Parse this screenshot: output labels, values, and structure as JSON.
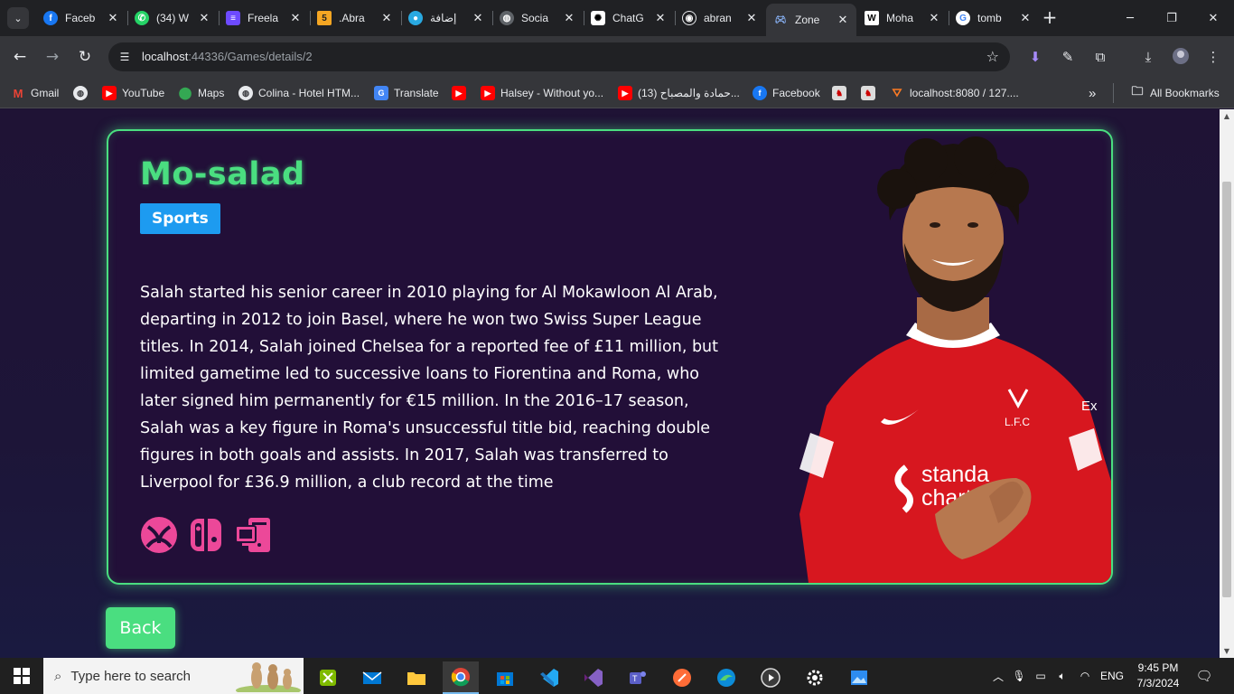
{
  "browser": {
    "tabs": [
      {
        "label": "Faceb",
        "icon": "facebook-icon",
        "color": "#1877f2"
      },
      {
        "label": "(34) W",
        "icon": "whatsapp-icon",
        "color": "#25d366"
      },
      {
        "label": "Freela",
        "icon": "freelancer-icon",
        "color": "#6d4aff"
      },
      {
        "label": ".Abra",
        "icon": "five-icon",
        "color": "#f5a623"
      },
      {
        "label": "إضافة",
        "icon": "circle-icon",
        "color": "#29a9e1"
      },
      {
        "label": "Socia",
        "icon": "globe-icon",
        "color": "#9aa0a6"
      },
      {
        "label": "ChatG",
        "icon": "chatgpt-icon",
        "color": "#ffffff"
      },
      {
        "label": "abran",
        "icon": "github-icon",
        "color": "#ffffff"
      },
      {
        "label": "Zone",
        "icon": "gamepad-icon",
        "color": "#8ab4f8",
        "active": true
      },
      {
        "label": "Moha",
        "icon": "wikipedia-icon",
        "color": "#ffffff"
      },
      {
        "label": "tomb",
        "icon": "google-icon",
        "color": "#ffffff"
      }
    ],
    "url_host": "localhost",
    "url_path": ":44336/Games/details/2",
    "bookmarks": [
      {
        "label": "Gmail",
        "icon": "gmail-icon"
      },
      {
        "label": "",
        "icon": "globe-icon"
      },
      {
        "label": "YouTube",
        "icon": "youtube-icon"
      },
      {
        "label": "Maps",
        "icon": "maps-icon"
      },
      {
        "label": "Colina - Hotel HTM...",
        "icon": "globe-icon"
      },
      {
        "label": "Translate",
        "icon": "translate-icon"
      },
      {
        "label": "",
        "icon": "youtube-icon"
      },
      {
        "label": "Halsey - Without yo...",
        "icon": "youtube-icon"
      },
      {
        "label": "(13) حمادة والمصباح...",
        "icon": "youtube-icon"
      },
      {
        "label": "Facebook",
        "icon": "facebook-icon"
      },
      {
        "label": "",
        "icon": "game-icon"
      },
      {
        "label": "",
        "icon": "game-icon"
      },
      {
        "label": "localhost:8080 / 127....",
        "icon": "xampp-icon"
      }
    ],
    "more_bookmarks": "»",
    "all_bookmarks": "All Bookmarks"
  },
  "game": {
    "title": "Mo-salad",
    "category": "Sports",
    "description": "Salah started his senior career in 2010 playing for Al Mokawloon Al Arab, departing in 2012 to join Basel, where he won two Swiss Super League titles. In 2014, Salah joined Chelsea for a reported fee of £11 million, but limited gametime led to successive loans to Fiorentina and Roma, who later signed him permanently for €15 million. In the 2016–17 season, Salah was a key figure in Roma's unsuccessful title bid, reaching double figures in both goals and assists. In 2017, Salah was transferred to Liverpool for £36.9 million, a club record at the time",
    "platforms": [
      "xbox-icon",
      "nintendo-switch-icon",
      "pc-icon"
    ],
    "image_text": {
      "sponsor_line1": "standa",
      "sponsor_line2": "chart",
      "crest": "L.F.C",
      "sleeve": "Ex"
    },
    "back_label": "Back"
  },
  "taskbar": {
    "search_placeholder": "Type here to search",
    "apps": [
      "snip-icon",
      "mail-icon",
      "file-explorer-icon",
      "chrome-icon",
      "store-icon",
      "vscode-icon",
      "visual-studio-icon",
      "teams-icon",
      "postman-icon",
      "edge-icon",
      "media-player-icon",
      "settings-icon",
      "photos-icon"
    ],
    "language": "ENG",
    "time": "9:45 PM",
    "date": "7/3/2024"
  },
  "colors": {
    "accent_green": "#4ade80",
    "category_blue": "#1d9bf0",
    "platform_pink": "#ec4899",
    "background": "#1f1335"
  }
}
